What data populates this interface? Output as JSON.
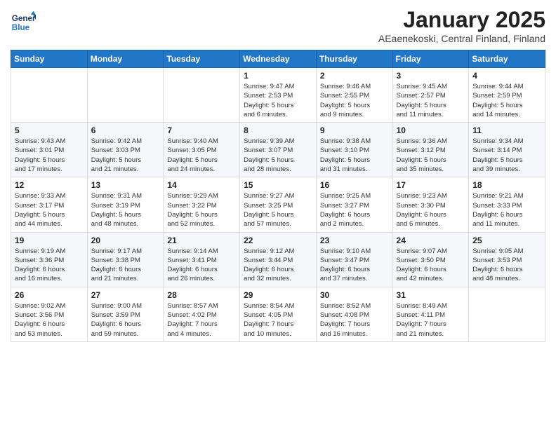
{
  "header": {
    "logo_line1": "General",
    "logo_line2": "Blue",
    "main_title": "January 2025",
    "subtitle": "AEaenekoski, Central Finland, Finland"
  },
  "weekdays": [
    "Sunday",
    "Monday",
    "Tuesday",
    "Wednesday",
    "Thursday",
    "Friday",
    "Saturday"
  ],
  "weeks": [
    [
      {
        "day": "",
        "info": ""
      },
      {
        "day": "",
        "info": ""
      },
      {
        "day": "",
        "info": ""
      },
      {
        "day": "1",
        "info": "Sunrise: 9:47 AM\nSunset: 2:53 PM\nDaylight: 5 hours\nand 6 minutes."
      },
      {
        "day": "2",
        "info": "Sunrise: 9:46 AM\nSunset: 2:55 PM\nDaylight: 5 hours\nand 9 minutes."
      },
      {
        "day": "3",
        "info": "Sunrise: 9:45 AM\nSunset: 2:57 PM\nDaylight: 5 hours\nand 11 minutes."
      },
      {
        "day": "4",
        "info": "Sunrise: 9:44 AM\nSunset: 2:59 PM\nDaylight: 5 hours\nand 14 minutes."
      }
    ],
    [
      {
        "day": "5",
        "info": "Sunrise: 9:43 AM\nSunset: 3:01 PM\nDaylight: 5 hours\nand 17 minutes."
      },
      {
        "day": "6",
        "info": "Sunrise: 9:42 AM\nSunset: 3:03 PM\nDaylight: 5 hours\nand 21 minutes."
      },
      {
        "day": "7",
        "info": "Sunrise: 9:40 AM\nSunset: 3:05 PM\nDaylight: 5 hours\nand 24 minutes."
      },
      {
        "day": "8",
        "info": "Sunrise: 9:39 AM\nSunset: 3:07 PM\nDaylight: 5 hours\nand 28 minutes."
      },
      {
        "day": "9",
        "info": "Sunrise: 9:38 AM\nSunset: 3:10 PM\nDaylight: 5 hours\nand 31 minutes."
      },
      {
        "day": "10",
        "info": "Sunrise: 9:36 AM\nSunset: 3:12 PM\nDaylight: 5 hours\nand 35 minutes."
      },
      {
        "day": "11",
        "info": "Sunrise: 9:34 AM\nSunset: 3:14 PM\nDaylight: 5 hours\nand 39 minutes."
      }
    ],
    [
      {
        "day": "12",
        "info": "Sunrise: 9:33 AM\nSunset: 3:17 PM\nDaylight: 5 hours\nand 44 minutes."
      },
      {
        "day": "13",
        "info": "Sunrise: 9:31 AM\nSunset: 3:19 PM\nDaylight: 5 hours\nand 48 minutes."
      },
      {
        "day": "14",
        "info": "Sunrise: 9:29 AM\nSunset: 3:22 PM\nDaylight: 5 hours\nand 52 minutes."
      },
      {
        "day": "15",
        "info": "Sunrise: 9:27 AM\nSunset: 3:25 PM\nDaylight: 5 hours\nand 57 minutes."
      },
      {
        "day": "16",
        "info": "Sunrise: 9:25 AM\nSunset: 3:27 PM\nDaylight: 6 hours\nand 2 minutes."
      },
      {
        "day": "17",
        "info": "Sunrise: 9:23 AM\nSunset: 3:30 PM\nDaylight: 6 hours\nand 6 minutes."
      },
      {
        "day": "18",
        "info": "Sunrise: 9:21 AM\nSunset: 3:33 PM\nDaylight: 6 hours\nand 11 minutes."
      }
    ],
    [
      {
        "day": "19",
        "info": "Sunrise: 9:19 AM\nSunset: 3:36 PM\nDaylight: 6 hours\nand 16 minutes."
      },
      {
        "day": "20",
        "info": "Sunrise: 9:17 AM\nSunset: 3:38 PM\nDaylight: 6 hours\nand 21 minutes."
      },
      {
        "day": "21",
        "info": "Sunrise: 9:14 AM\nSunset: 3:41 PM\nDaylight: 6 hours\nand 26 minutes."
      },
      {
        "day": "22",
        "info": "Sunrise: 9:12 AM\nSunset: 3:44 PM\nDaylight: 6 hours\nand 32 minutes."
      },
      {
        "day": "23",
        "info": "Sunrise: 9:10 AM\nSunset: 3:47 PM\nDaylight: 6 hours\nand 37 minutes."
      },
      {
        "day": "24",
        "info": "Sunrise: 9:07 AM\nSunset: 3:50 PM\nDaylight: 6 hours\nand 42 minutes."
      },
      {
        "day": "25",
        "info": "Sunrise: 9:05 AM\nSunset: 3:53 PM\nDaylight: 6 hours\nand 48 minutes."
      }
    ],
    [
      {
        "day": "26",
        "info": "Sunrise: 9:02 AM\nSunset: 3:56 PM\nDaylight: 6 hours\nand 53 minutes."
      },
      {
        "day": "27",
        "info": "Sunrise: 9:00 AM\nSunset: 3:59 PM\nDaylight: 6 hours\nand 59 minutes."
      },
      {
        "day": "28",
        "info": "Sunrise: 8:57 AM\nSunset: 4:02 PM\nDaylight: 7 hours\nand 4 minutes."
      },
      {
        "day": "29",
        "info": "Sunrise: 8:54 AM\nSunset: 4:05 PM\nDaylight: 7 hours\nand 10 minutes."
      },
      {
        "day": "30",
        "info": "Sunrise: 8:52 AM\nSunset: 4:08 PM\nDaylight: 7 hours\nand 16 minutes."
      },
      {
        "day": "31",
        "info": "Sunrise: 8:49 AM\nSunset: 4:11 PM\nDaylight: 7 hours\nand 21 minutes."
      },
      {
        "day": "",
        "info": ""
      }
    ]
  ]
}
